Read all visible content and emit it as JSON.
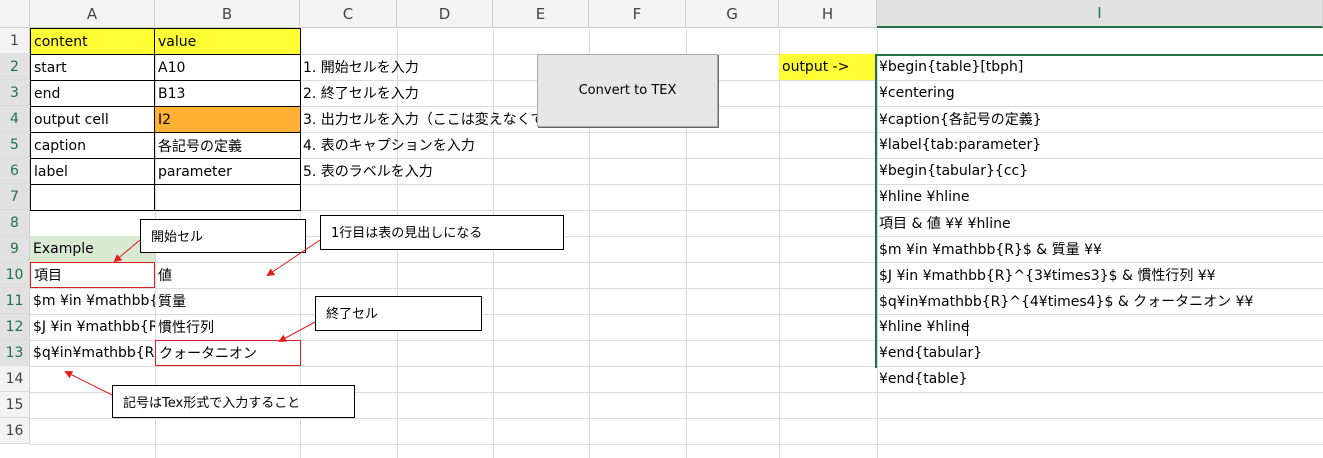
{
  "columns": [
    "A",
    "B",
    "C",
    "D",
    "E",
    "F",
    "G",
    "H",
    "I"
  ],
  "rows": [
    "1",
    "2",
    "3",
    "4",
    "5",
    "6",
    "7",
    "8",
    "9",
    "10",
    "11",
    "12",
    "13",
    "14",
    "15",
    "16"
  ],
  "params": {
    "header_content": "content",
    "header_value": "value",
    "start_label": "start",
    "start_value": "A10",
    "end_label": "end",
    "end_value": "B13",
    "output_label": "output cell",
    "output_value": "I2",
    "caption_label": "caption",
    "caption_value": "各記号の定義",
    "label_label": "label",
    "label_value": "parameter"
  },
  "steps": [
    "1. 開始セルを入力",
    "2. 終了セルを入力",
    "3. 出力セルを入力（ここは変えなくて",
    "4. 表のキャプションを入力",
    "5. 表のラベルを入力"
  ],
  "button_label": "Convert to TEX",
  "output_marker": "output ->",
  "example": {
    "title": "Example",
    "rows": [
      [
        "項目",
        "値"
      ],
      [
        "$m ¥in ¥mathbb{",
        "質量"
      ],
      [
        "$J ¥in ¥mathbb{R",
        "慣性行列"
      ],
      [
        "$q¥in¥mathbb{R}",
        "クォータニオン"
      ]
    ]
  },
  "tex_output": [
    "¥begin{table}[tbph]",
    "¥centering",
    "¥caption{各記号の定義}",
    "¥label{tab:parameter}",
    "¥begin{tabular}{cc}",
    "¥hline ¥hline",
    "項目 & 値 ¥¥ ¥hline",
    "$m ¥in ¥mathbb{R}$ & 質量 ¥¥",
    "$J ¥in ¥mathbb{R}^{3¥times3}$ & 慣性行列 ¥¥",
    "$q¥in¥mathbb{R}^{4¥times4}$ & クォータニオン ¥¥",
    "¥hline ¥hline",
    "¥end{tabular}",
    "¥end{table}"
  ],
  "callouts": {
    "start_cell": "開始セル",
    "header_row": "1行目は表の見出しになる",
    "end_cell": "終了セル",
    "tex_format": "記号はTex形式で入力すること"
  },
  "colors": {
    "header_yellow": "#ffff33",
    "output_orange": "#ffb133",
    "example_green": "#d9ead3",
    "arrow_red": "#e01e1e",
    "selection_green": "#217346"
  }
}
